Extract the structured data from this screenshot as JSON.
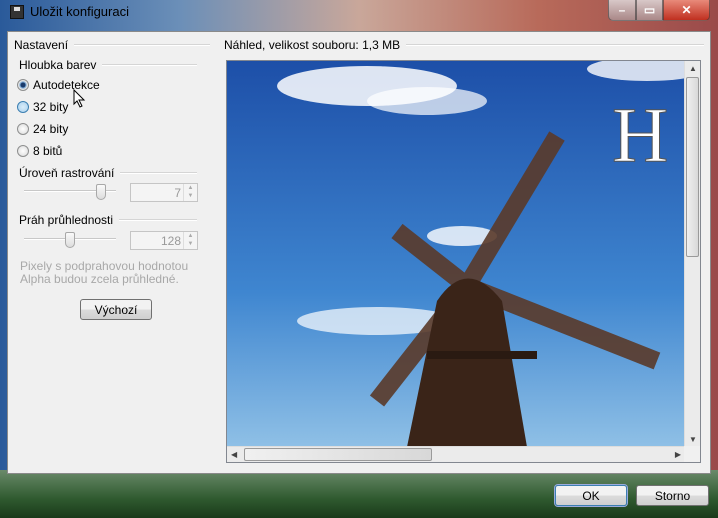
{
  "window": {
    "title": "Uložit konfiguraci"
  },
  "settings": {
    "group_label": "Nastavení",
    "color_depth": {
      "label": "Hloubka barev",
      "options": [
        {
          "label": "Autodetekce",
          "selected": true
        },
        {
          "label": "32 bity",
          "selected": false
        },
        {
          "label": "24 bity",
          "selected": false
        },
        {
          "label": "8 bitů",
          "selected": false
        }
      ]
    },
    "dither": {
      "label": "Úroveň rastrování",
      "value": "7",
      "slider_fraction": 0.85
    },
    "transparency": {
      "label": "Práh průhlednosti",
      "value": "128",
      "slider_fraction": 0.5,
      "hint_line1": "Pixely s podprahovou hodnotou",
      "hint_line2": "Alpha budou zcela průhledné."
    },
    "default_button": "Výchozí"
  },
  "preview": {
    "label": "Náhled, velikost souboru: 1,3 MB",
    "image_text": "H"
  },
  "buttons": {
    "ok": "OK",
    "cancel": "Storno"
  }
}
